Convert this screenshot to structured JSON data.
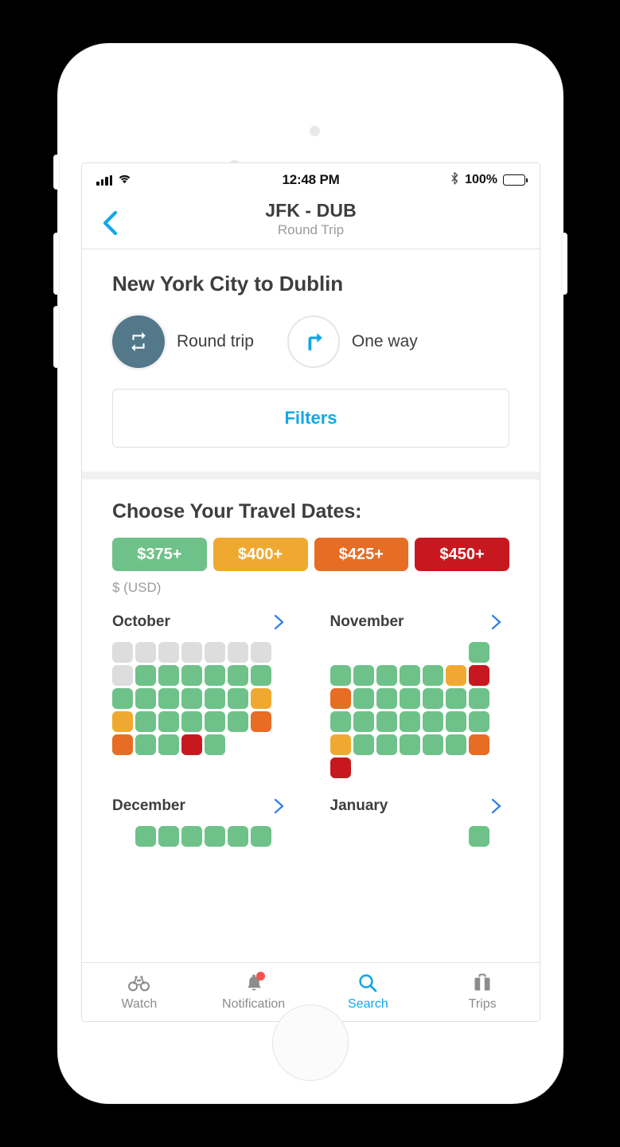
{
  "status_bar": {
    "time": "12:48 PM",
    "battery_percent": "100%",
    "signal_icon": "cellular-signal-icon",
    "wifi_icon": "wifi-icon",
    "bluetooth_icon": "bluetooth-icon",
    "battery_icon": "battery-full-icon"
  },
  "nav": {
    "back_icon": "chevron-left-icon",
    "title": "JFK - DUB",
    "subtitle": "Round Trip"
  },
  "trip": {
    "route_title": "New York City to Dublin",
    "options": [
      {
        "label": "Round trip",
        "icon": "repeat-icon",
        "selected": true
      },
      {
        "label": "One way",
        "icon": "turn-right-arrow-icon",
        "selected": false
      }
    ],
    "filters_label": "Filters"
  },
  "dates": {
    "heading": "Choose Your Travel Dates:",
    "currency_note": "$ (USD)",
    "legend": [
      {
        "label": "$375+",
        "color": "#6ec289"
      },
      {
        "label": "$400+",
        "color": "#f0a930"
      },
      {
        "label": "$425+",
        "color": "#e76d24"
      },
      {
        "label": "$450+",
        "color": "#c8181f"
      }
    ],
    "arrow_icon": "chevron-right-icon",
    "months": [
      {
        "name": "October",
        "rows": [
          [
            "gray",
            "gray",
            "gray",
            "gray",
            "gray",
            "gray",
            "gray"
          ],
          [
            "gray",
            "green",
            "green",
            "green",
            "green",
            "green",
            "green"
          ],
          [
            "green",
            "green",
            "green",
            "green",
            "green",
            "green",
            "orange"
          ],
          [
            "orange",
            "green",
            "green",
            "green",
            "green",
            "green",
            "darkorange"
          ],
          [
            "darkorange",
            "green",
            "green",
            "red",
            "green",
            "none",
            "none"
          ]
        ]
      },
      {
        "name": "November",
        "rows": [
          [
            "none",
            "none",
            "none",
            "none",
            "none",
            "none",
            "green"
          ],
          [
            "green",
            "green",
            "green",
            "green",
            "green",
            "orange",
            "red"
          ],
          [
            "darkorange",
            "green",
            "green",
            "green",
            "green",
            "green",
            "green"
          ],
          [
            "green",
            "green",
            "green",
            "green",
            "green",
            "green",
            "green"
          ],
          [
            "orange",
            "green",
            "green",
            "green",
            "green",
            "green",
            "darkorange"
          ],
          [
            "red",
            "none",
            "none",
            "none",
            "none",
            "none",
            "none"
          ]
        ]
      },
      {
        "name": "December",
        "rows": [
          [
            "none",
            "green",
            "green",
            "green",
            "green",
            "green",
            "green"
          ]
        ]
      },
      {
        "name": "January",
        "rows": [
          [
            "none",
            "none",
            "none",
            "none",
            "none",
            "none",
            "green"
          ]
        ]
      }
    ],
    "cell_colors": {
      "gray": "#dddddd",
      "green": "#6ec289",
      "orange": "#f0a930",
      "darkorange": "#e76d24",
      "red": "#c8181f"
    }
  },
  "tabs": [
    {
      "label": "Watch",
      "icon": "binoculars-icon",
      "active": false,
      "badge": false
    },
    {
      "label": "Notification",
      "icon": "bell-icon",
      "active": false,
      "badge": true
    },
    {
      "label": "Search",
      "icon": "magnifier-icon",
      "active": true,
      "badge": false
    },
    {
      "label": "Trips",
      "icon": "suitcase-icon",
      "active": false,
      "badge": false
    }
  ],
  "theme": {
    "accent_blue": "#12a7e8",
    "selected_circle": "#52788a",
    "text_dark": "#3e3e3e",
    "text_muted": "#9b9b9b"
  }
}
